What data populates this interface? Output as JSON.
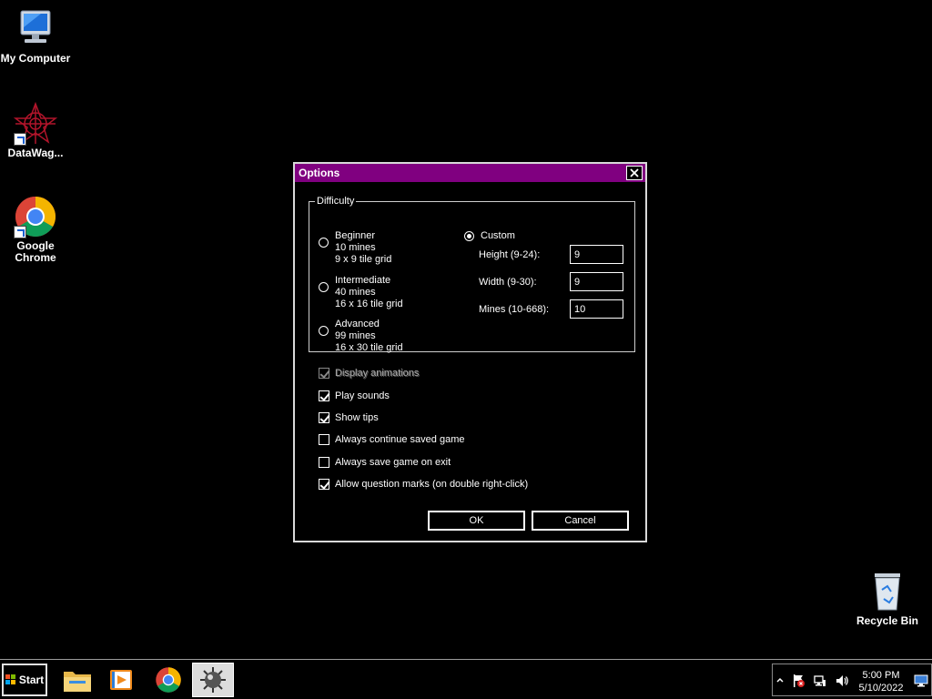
{
  "desktop": {
    "icons": [
      {
        "label": "My Computer"
      },
      {
        "label": "DataWag..."
      },
      {
        "label": "Google Chrome"
      },
      {
        "label": "Recycle Bin"
      }
    ]
  },
  "dialog": {
    "title": "Options",
    "difficulty": {
      "legend": "Difficulty",
      "beginner": {
        "title": "Beginner",
        "mines": "10 mines",
        "grid": "9 x 9 tile grid",
        "selected": false
      },
      "intermediate": {
        "title": "Intermediate",
        "mines": "40 mines",
        "grid": "16 x 16 tile grid",
        "selected": false
      },
      "advanced": {
        "title": "Advanced",
        "mines": "99 mines",
        "grid": "16 x 30 tile grid",
        "selected": false
      },
      "custom": {
        "title": "Custom",
        "selected": true,
        "height_label": "Height (9-24):",
        "height_value": "9",
        "width_label": "Width (9-30):",
        "width_value": "9",
        "mines_label": "Mines (10-668):",
        "mines_value": "10"
      }
    },
    "options": [
      {
        "label": "Display animations",
        "checked": true,
        "disabled": true
      },
      {
        "label": "Play sounds",
        "checked": true,
        "disabled": false
      },
      {
        "label": "Show tips",
        "checked": true,
        "disabled": false
      },
      {
        "label": "Always continue saved game",
        "checked": false,
        "disabled": false
      },
      {
        "label": "Always save game on exit",
        "checked": false,
        "disabled": false
      },
      {
        "label": "Allow question marks (on double right-click)",
        "checked": true,
        "disabled": false
      }
    ],
    "ok_label": "OK",
    "cancel_label": "Cancel"
  },
  "taskbar": {
    "start_label": "Start",
    "apps": [
      "file-explorer-icon",
      "media-player-icon",
      "chrome-icon",
      "minesweeper-icon"
    ],
    "clock_time": "5:00 PM",
    "clock_date": "5/10/2022"
  },
  "colors": {
    "titlebar": "#800080",
    "background": "#000000",
    "foreground": "#ffffff"
  }
}
